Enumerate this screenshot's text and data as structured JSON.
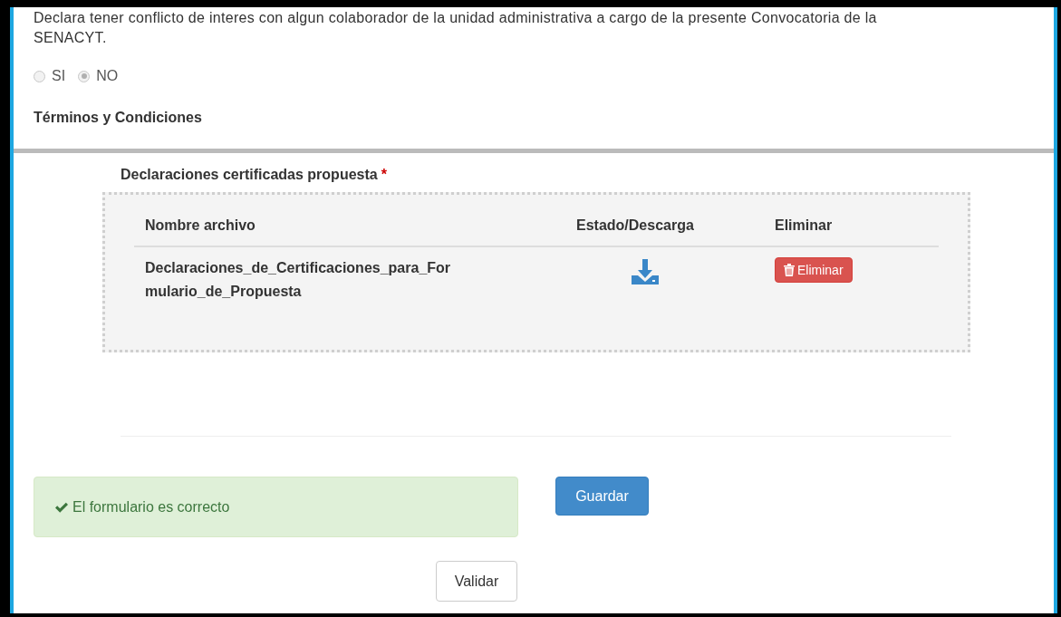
{
  "declaration": {
    "lines": [
      "Declara tener conflicto de interes con algun colaborador de la unidad administrativa a cargo de la presente Convocatoria de la",
      "SENACYT."
    ]
  },
  "conflict_options": {
    "disabled": true,
    "options": [
      {
        "label": "SI",
        "selected": false
      },
      {
        "label": "NO",
        "selected": true
      }
    ]
  },
  "terms_title": "Términos y Condiciones",
  "upload": {
    "label": "Declaraciones certificadas propuesta",
    "required": true,
    "required_mark": "*",
    "columns": [
      "Nombre archivo",
      "Estado/Descarga",
      "Eliminar"
    ],
    "rows": [
      {
        "file_name": "Declaraciones_de_Certificaciones_para_Formulario_de_Propuesta",
        "delete_label": "Eliminar"
      }
    ]
  },
  "alert": {
    "kind": "success",
    "text": "El formulario es correcto"
  },
  "buttons": {
    "save": "Guardar",
    "validate": "Validar"
  }
}
